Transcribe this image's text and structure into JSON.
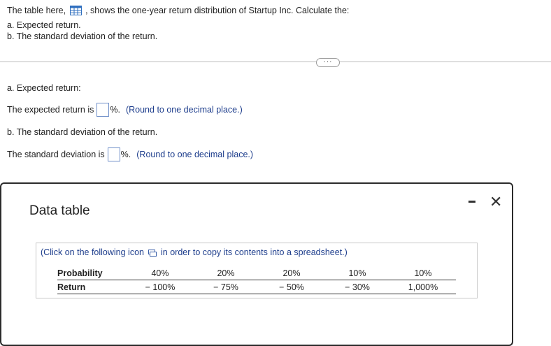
{
  "question": {
    "intro_before": "The table here,",
    "intro_after": ", shows the one-year return distribution of Startup Inc. Calculate the:",
    "part_a": "a. Expected return.",
    "part_b": "b. The standard deviation of the return."
  },
  "answers": {
    "a_heading": "a. Expected return:",
    "a_prefix": "The expected return is",
    "a_value": "",
    "a_suffix": "%.",
    "a_hint": "(Round to one decimal place.)",
    "b_heading": "b. The standard deviation of the return.",
    "b_prefix": "The standard deviation is",
    "b_value": "",
    "b_suffix": "%.",
    "b_hint": "(Round to one decimal place.)"
  },
  "more_button": "···",
  "dialog": {
    "title": "Data table",
    "close": "✕",
    "copy_before": "(Click on the following icon",
    "copy_after": "in order to copy its contents into a spreadsheet.)",
    "table": {
      "row_labels": [
        "Probability",
        "Return"
      ],
      "probability": [
        "40%",
        "20%",
        "20%",
        "10%",
        "10%"
      ],
      "return": [
        "− 100%",
        "− 75%",
        "− 50%",
        "− 30%",
        "1,000%"
      ]
    }
  },
  "icons": [
    "table-icon",
    "copy-icon",
    "minimize-icon",
    "close-icon"
  ]
}
